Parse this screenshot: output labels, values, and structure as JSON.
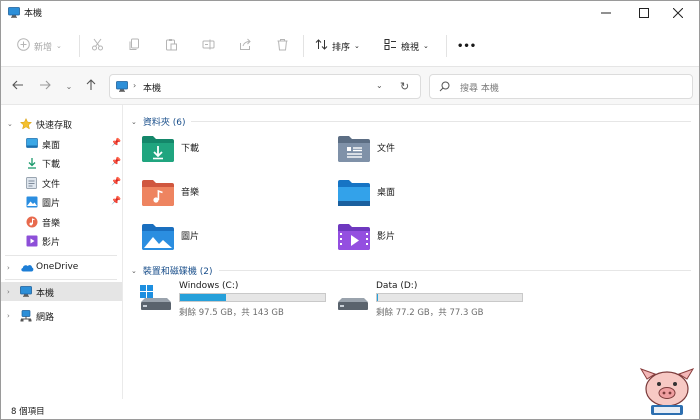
{
  "window": {
    "title": "本機"
  },
  "toolbar": {
    "new_label": "新增",
    "sort_label": "排序",
    "view_label": "檢視",
    "more_label": "•••"
  },
  "address": {
    "path": "本機",
    "chevron": "›"
  },
  "search": {
    "placeholder": "搜尋 本機"
  },
  "sidebar": {
    "quick_access": "快速存取",
    "quick_items": [
      {
        "label": "桌面",
        "icon": "desktop-icon",
        "pinned": true
      },
      {
        "label": "下載",
        "icon": "download-icon",
        "pinned": true
      },
      {
        "label": "文件",
        "icon": "document-icon",
        "pinned": true
      },
      {
        "label": "圖片",
        "icon": "pictures-icon",
        "pinned": true
      },
      {
        "label": "音樂",
        "icon": "music-icon",
        "pinned": false
      },
      {
        "label": "影片",
        "icon": "video-icon",
        "pinned": false
      }
    ],
    "onedrive": "OneDrive",
    "this_pc": "本機",
    "network": "網路"
  },
  "main": {
    "folders_header": "資料夾 (6)",
    "folders": [
      {
        "label": "下載",
        "icon": "download-folder-icon"
      },
      {
        "label": "文件",
        "icon": "documents-folder-icon"
      },
      {
        "label": "音樂",
        "icon": "music-folder-icon"
      },
      {
        "label": "桌面",
        "icon": "desktop-folder-icon"
      },
      {
        "label": "圖片",
        "icon": "pictures-folder-icon"
      },
      {
        "label": "影片",
        "icon": "videos-folder-icon"
      }
    ],
    "drives_header": "裝置和磁碟機 (2)",
    "drives": [
      {
        "name": "Windows (C:)",
        "info": "剩餘 97.5 GB，共 143 GB",
        "used_fraction": 0.318,
        "icon": "windows-drive-icon"
      },
      {
        "name": "Data (D:)",
        "info": "剩餘 77.2 GB，共 77.3 GB",
        "used_fraction": 0.001,
        "icon": "hard-drive-icon"
      }
    ]
  },
  "status": {
    "item_count": "8 個項目"
  },
  "colors": {
    "accent": "#26a0da",
    "header_blue": "#1a4f8b",
    "selected_bg": "#e5e5e5"
  }
}
